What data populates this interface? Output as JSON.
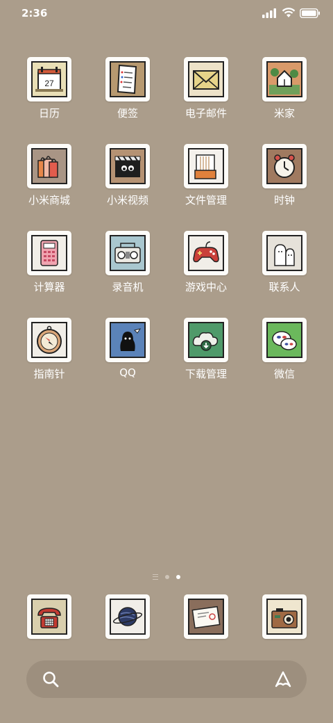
{
  "status_bar": {
    "time": "2:36"
  },
  "apps": [
    {
      "label": "日历",
      "icon": "calendar-icon",
      "day": "27",
      "bg": "#e9dfb6"
    },
    {
      "label": "便签",
      "icon": "notes-icon",
      "bg": "#b79970"
    },
    {
      "label": "电子邮件",
      "icon": "mail-icon",
      "bg": "#ede2c8"
    },
    {
      "label": "米家",
      "icon": "home-icon",
      "bg": "#d99a6a"
    },
    {
      "label": "小米商城",
      "icon": "shopping-bags-icon",
      "bg": "#a99585"
    },
    {
      "label": "小米视频",
      "icon": "video-clapper-icon",
      "bg": "#b59273"
    },
    {
      "label": "文件管理",
      "icon": "file-folder-icon",
      "bg": "#f4f1ec"
    },
    {
      "label": "时钟",
      "icon": "alarm-clock-icon",
      "bg": "#a07a60"
    },
    {
      "label": "计算器",
      "icon": "calculator-icon",
      "bg": "#f1eee8"
    },
    {
      "label": "录音机",
      "icon": "radio-recorder-icon",
      "bg": "#a9c7cf"
    },
    {
      "label": "游戏中心",
      "icon": "gamepad-icon",
      "bg": "#f1eee8"
    },
    {
      "label": "联系人",
      "icon": "contacts-ghost-icon",
      "bg": "#e6e2da"
    },
    {
      "label": "指南针",
      "icon": "compass-icon",
      "bg": "#f1eee8"
    },
    {
      "label": "QQ",
      "icon": "qq-penguin-icon",
      "bg": "#5b83b9"
    },
    {
      "label": "下载管理",
      "icon": "download-cloud-icon",
      "bg": "#4f9a6a"
    },
    {
      "label": "微信",
      "icon": "wechat-icon",
      "bg": "#6bb85c"
    }
  ],
  "dock": [
    {
      "icon": "phone-icon",
      "bg": "#d9cfad"
    },
    {
      "icon": "browser-planet-icon",
      "bg": "#f1eee8"
    },
    {
      "icon": "messages-envelope-icon",
      "bg": "#8a6e5c"
    },
    {
      "icon": "camera-icon",
      "bg": "#efe6cf"
    }
  ],
  "page_indicator": {
    "count": 2,
    "active": 2
  },
  "search": {
    "icon": "search-icon",
    "assistant_icon": "assistant-icon"
  }
}
